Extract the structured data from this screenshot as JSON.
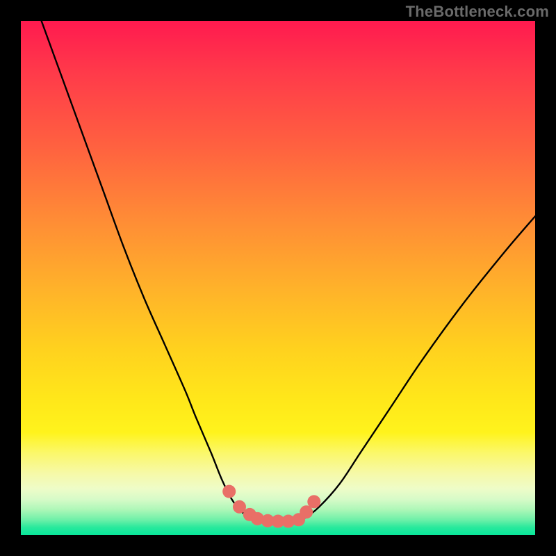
{
  "watermark": "TheBottleneck.com",
  "chart_data": {
    "type": "line",
    "title": "",
    "xlabel": "",
    "ylabel": "",
    "xlim": [
      0,
      100
    ],
    "ylim": [
      0,
      100
    ],
    "grid": false,
    "legend": false,
    "series": [
      {
        "name": "curve",
        "x": [
          4,
          8,
          12,
          16,
          20,
          24,
          28,
          32,
          34,
          37,
          39,
          41,
          43,
          45,
          47,
          49,
          51,
          53,
          55,
          58,
          62,
          66,
          72,
          78,
          86,
          94,
          100
        ],
        "y": [
          100,
          89,
          78,
          67,
          56,
          46,
          37,
          28,
          23,
          16,
          11,
          7,
          4.5,
          3.2,
          2.6,
          2.4,
          2.4,
          2.6,
          3.2,
          5.5,
          10,
          16,
          25,
          34,
          45,
          55,
          62
        ]
      }
    ],
    "markers": {
      "name": "flat-region-dots",
      "color": "#e96f67",
      "x": [
        40.5,
        42.5,
        44.5,
        46,
        48,
        50,
        52,
        54,
        55.5,
        57
      ],
      "y": [
        8.5,
        5.5,
        4.0,
        3.2,
        2.8,
        2.7,
        2.7,
        3.0,
        4.5,
        6.5
      ]
    },
    "background_gradient": {
      "top": "#ff1a4f",
      "mid": "#ffe81a",
      "bottom": "#08e79b"
    }
  }
}
